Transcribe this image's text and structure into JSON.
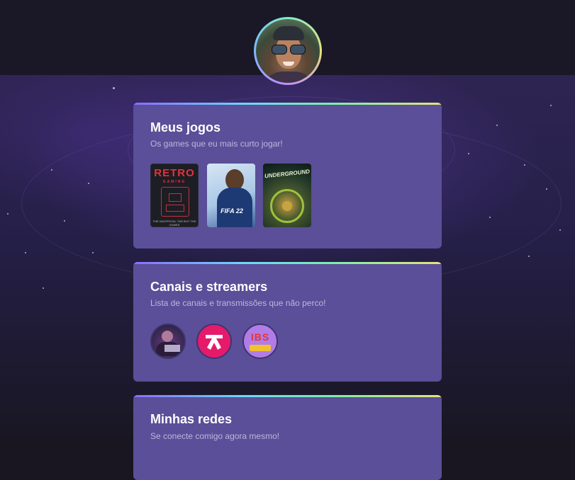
{
  "profile": {
    "avatar_icon": "profile-photo"
  },
  "cards": {
    "games": {
      "title": "Meus jogos",
      "subtitle": "Os games que eu mais curto jogar!",
      "items": [
        {
          "label": "RETRO",
          "sublabel": "GAMING",
          "caption": "THE UNOFFICIAL THE BUY THE GAMES",
          "colors": {
            "bg": "#1d1d24",
            "accent": "#e0343c"
          }
        },
        {
          "label": "FIFA 22",
          "colors": {
            "bg": "#a9c7e6",
            "accent": "#1e3a74"
          }
        },
        {
          "label": "UNDERGROUND",
          "colors": {
            "bg": "#1c3328",
            "accent": "#9ec23a"
          }
        }
      ]
    },
    "channels": {
      "title": "Canais e streamers",
      "subtitle": "Lista de canais e transmissões que não perco!",
      "items": [
        {
          "icon": "streamer-avatar-icon",
          "colors": {
            "bg": "#3b2a52"
          }
        },
        {
          "icon": "channel-logo-icon",
          "colors": {
            "bg": "#e51a6b"
          }
        },
        {
          "icon": "channel-badge-icon",
          "text": "IBS",
          "colors": {
            "bg": "#b17ce8"
          }
        }
      ]
    },
    "networks": {
      "title": "Minhas redes",
      "subtitle": "Se conecte comigo agora mesmo!"
    }
  },
  "colors": {
    "card_bg": "#5a4f98",
    "page_bg": "#191622",
    "accent_gradient": [
      "#8a6cff",
      "#6cd6ff",
      "#7cf0a8",
      "#e8e27a"
    ]
  }
}
